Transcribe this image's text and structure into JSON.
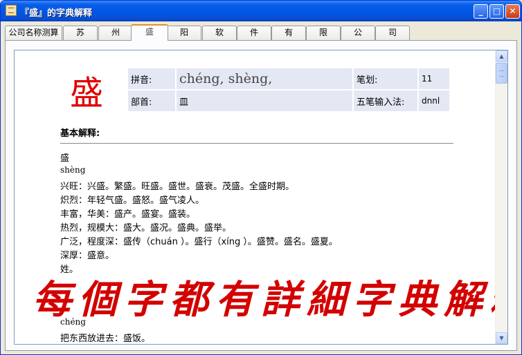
{
  "window": {
    "title": "『盛』的字典解释"
  },
  "titlebar_buttons": {
    "minimize": "_",
    "maximize": "□",
    "close": "✕"
  },
  "tabs": [
    "公司名称测算",
    "苏",
    "州",
    "盛",
    "阳",
    "软",
    "件",
    "有",
    "限",
    "公",
    "司"
  ],
  "active_tab_index": 3,
  "entry": {
    "character": "盛",
    "pinyin_label": "拼音:",
    "pinyin": "chéng, shèng,",
    "strokes_label": "笔划:",
    "strokes": "11",
    "radical_label": "部首:",
    "radical": "皿",
    "wubi_label": "五笔输入法:",
    "wubi": "dnnl"
  },
  "definition": {
    "heading": "基本解释:",
    "lines": [
      "盛",
      "shèng",
      "兴旺：兴盛。繁盛。旺盛。盛世。盛衰。茂盛。全盛时期。",
      "炽烈：年轻气盛。盛怒。盛气凌人。",
      "丰富，华美：盛产。盛宴。盛装。",
      "热烈，规模大：盛大。盛况。盛典。盛举。",
      "广泛，程度深：盛传（chuán ）。盛行（xíng ）。盛赞。盛名。盛夏。",
      "深厚：盛意。",
      "姓。",
      "chéng",
      "把东西放进去：盛饭。"
    ]
  },
  "overlay_text": "每個字都有詳細字典解釋",
  "scrollbar": {
    "up": "▲",
    "down": "▼"
  },
  "colors": {
    "character": "#e00000",
    "overlay_text": "#d30000",
    "info_cell": "#e4e8f4",
    "titlebar": "#0055e5"
  }
}
